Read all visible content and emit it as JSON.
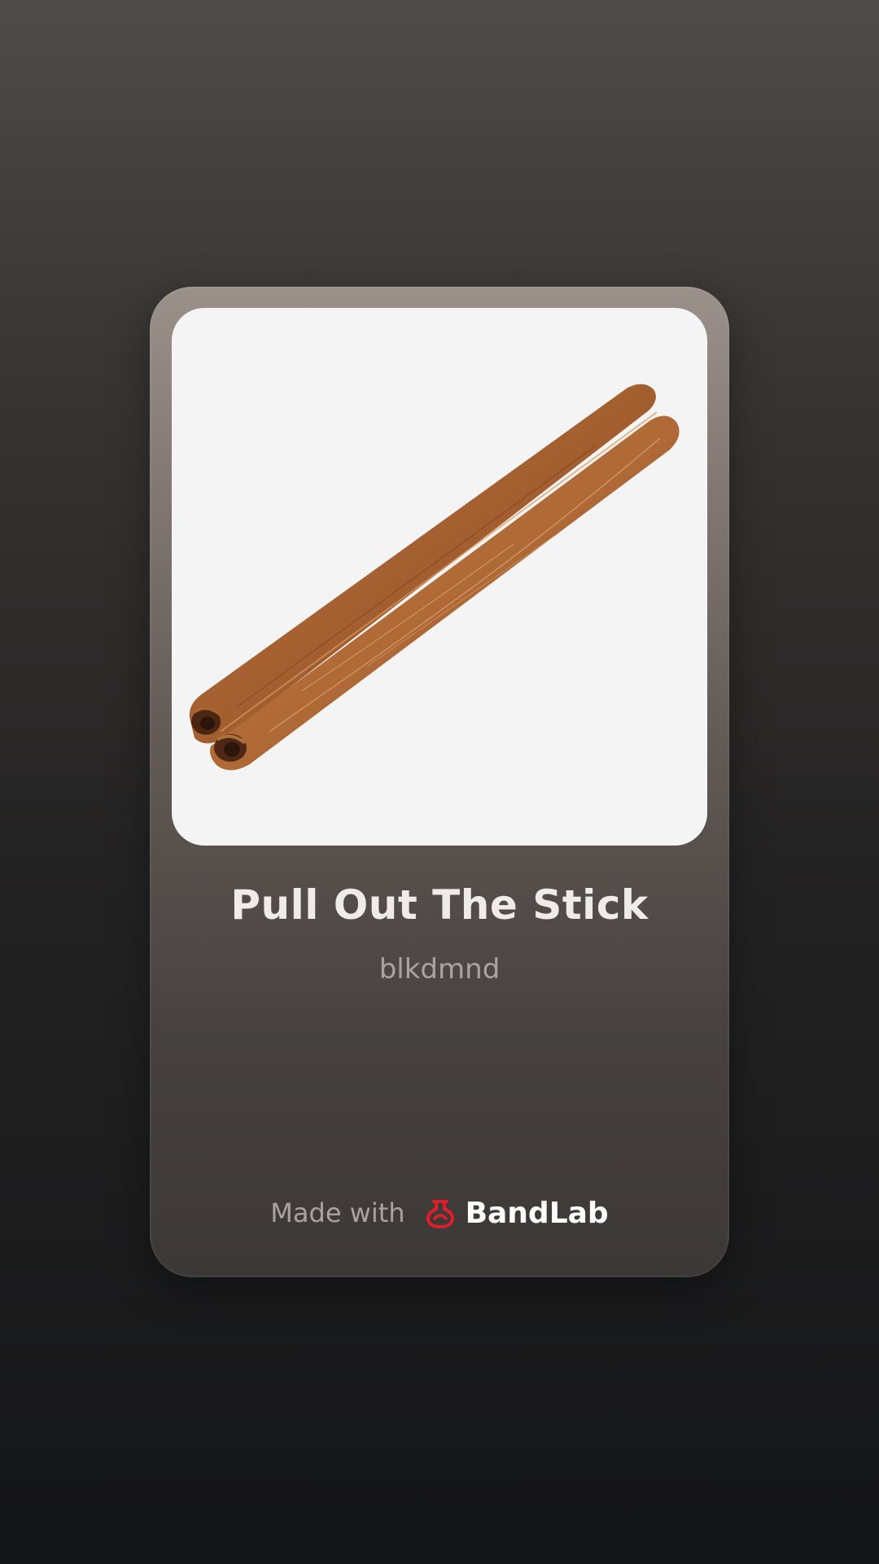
{
  "track": {
    "title": "Pull Out The Stick",
    "artist": "blkdmnd"
  },
  "artwork": {
    "icon": "cinnamon-stick-image",
    "background": "#f4f4f5"
  },
  "footer": {
    "made_with": "Made with",
    "brand": "BandLab",
    "logo_icon": "bandlab-logo-icon",
    "logo_color": "#e11d2a"
  }
}
